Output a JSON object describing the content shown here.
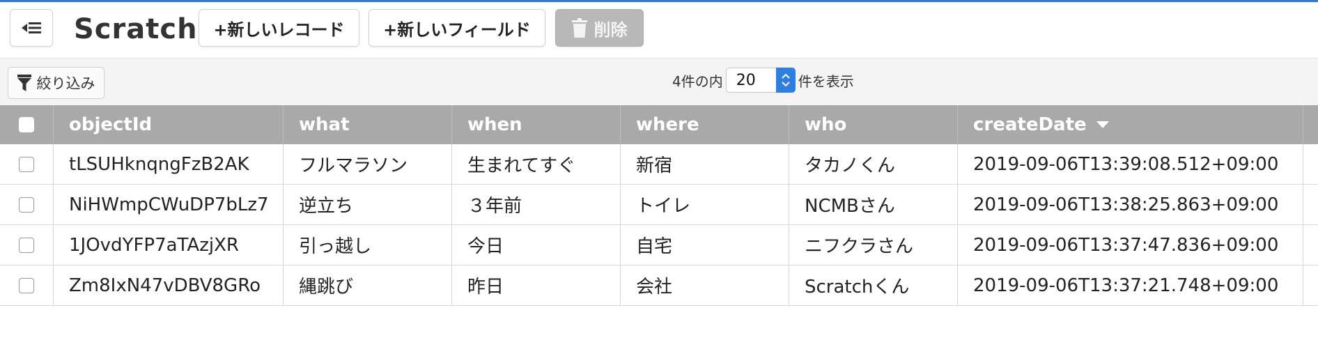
{
  "toolbar": {
    "title": "Scratch",
    "new_record_label": "+新しいレコード",
    "new_field_label": "+新しいフィールド",
    "delete_label": "削除"
  },
  "filterbar": {
    "filter_label": "絞り込み",
    "count_prefix": "4件の内",
    "page_size": "20",
    "count_suffix": "件を表示"
  },
  "table": {
    "columns": [
      "objectId",
      "what",
      "when",
      "where",
      "who",
      "createDate"
    ],
    "sort_column": "createDate",
    "sort_direction": "descending",
    "rows": [
      [
        "tLSUHknqngFzB2AK",
        "フルマラソン",
        "生まれてすぐ",
        "新宿",
        "タカノくん",
        "2019-09-06T13:39:08.512+09:00"
      ],
      [
        "NiHWmpCWuDP7bLz7",
        "逆立ち",
        "３年前",
        "トイレ",
        "NCMBさん",
        "2019-09-06T13:38:25.863+09:00"
      ],
      [
        "1JOvdYFP7aTAzjXR",
        "引っ越し",
        "今日",
        "自宅",
        "ニフクラさん",
        "2019-09-06T13:37:47.836+09:00"
      ],
      [
        "Zm8IxN47vDBV8GRo",
        "縄跳び",
        "昨日",
        "会社",
        "Scratchくん",
        "2019-09-06T13:37:21.748+09:00"
      ]
    ]
  },
  "colors": {
    "accent": "#2f7bd3",
    "header_bg": "#a9a9a9",
    "delete_disabled": "#b8b8b8"
  },
  "icons": {
    "back": "collapse-menu-icon",
    "delete": "trash-icon",
    "filter": "funnel-icon",
    "stepper": "chevron-up-down-icon",
    "sort": "sort-down-icon"
  }
}
